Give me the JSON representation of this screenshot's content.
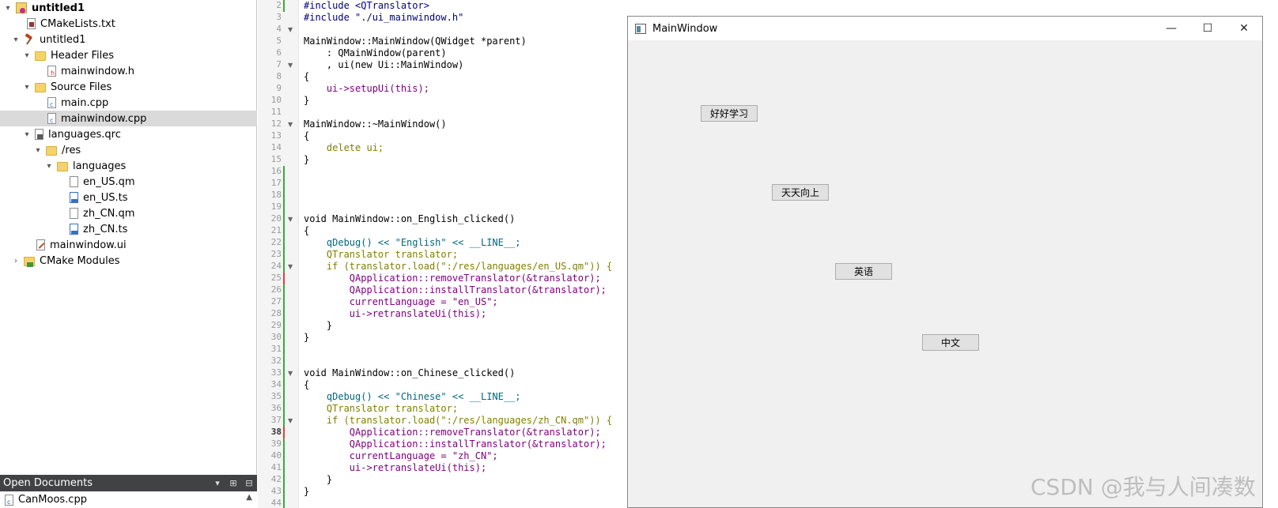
{
  "tree": [
    {
      "label": "untitled1",
      "icon": "project-icon",
      "bold": true
    },
    {
      "label": "CMakeLists.txt",
      "icon": "cmake-file-icon"
    },
    {
      "label": "untitled1",
      "icon": "hammer-icon"
    },
    {
      "label": "Header Files",
      "icon": "folder-icon"
    },
    {
      "label": "mainwindow.h",
      "icon": "header-file-icon"
    },
    {
      "label": "Source Files",
      "icon": "folder-icon"
    },
    {
      "label": "main.cpp",
      "icon": "cpp-file-icon"
    },
    {
      "label": "mainwindow.cpp",
      "icon": "cpp-file-icon",
      "selected": true
    },
    {
      "label": "languages.qrc",
      "icon": "qrc-file-icon"
    },
    {
      "label": "/res",
      "icon": "folder-icon"
    },
    {
      "label": "languages",
      "icon": "folder-icon"
    },
    {
      "label": "en_US.qm",
      "icon": "file-icon"
    },
    {
      "label": "en_US.ts",
      "icon": "ts-file-icon"
    },
    {
      "label": "zh_CN.qm",
      "icon": "file-icon"
    },
    {
      "label": "zh_CN.ts",
      "icon": "ts-file-icon"
    },
    {
      "label": "mainwindow.ui",
      "icon": "ui-file-icon"
    },
    {
      "label": "CMake Modules",
      "icon": "cmake-modules-icon"
    }
  ],
  "open_documents": {
    "title": "Open Documents",
    "items": [
      "CanMoos.cpp"
    ]
  },
  "editor": {
    "line_numbers": [
      "2",
      "3",
      "4",
      "5",
      "6",
      "7",
      "8",
      "9",
      "10",
      "11",
      "12",
      "13",
      "14",
      "15",
      "16",
      "17",
      "18",
      "19",
      "20",
      "21",
      "22",
      "23",
      "24",
      "25",
      "26",
      "27",
      "28",
      "29",
      "30",
      "31",
      "32",
      "33",
      "34",
      "35",
      "36",
      "37",
      "38",
      "39",
      "40",
      "41",
      "42",
      "43",
      "44"
    ],
    "current_line": "38",
    "code_lines": [
      "#include <QTranslator>",
      "#include \"./ui_mainwindow.h\"",
      "",
      "MainWindow::MainWindow(QWidget *parent)",
      "    : QMainWindow(parent)",
      "    , ui(new Ui::MainWindow)",
      "{",
      "    ui->setupUi(this);",
      "}",
      "",
      "MainWindow::~MainWindow()",
      "{",
      "    delete ui;",
      "}",
      "",
      "",
      "",
      "",
      "void MainWindow::on_English_clicked()",
      "{",
      "    qDebug() << \"English\" << __LINE__;",
      "    QTranslator translator;",
      "    if (translator.load(\":/res/languages/en_US.qm\")) {",
      "        QApplication::removeTranslator(&translator);",
      "        QApplication::installTranslator(&translator);",
      "        currentLanguage = \"en_US\";",
      "        ui->retranslateUi(this);",
      "    }",
      "}",
      "",
      "",
      "void MainWindow::on_Chinese_clicked()",
      "{",
      "    qDebug() << \"Chinese\" << __LINE__;",
      "    QTranslator translator;",
      "    if (translator.load(\":/res/languages/zh_CN.qm\")) {",
      "        QApplication::removeTranslator(&translator);",
      "        QApplication::installTranslator(&translator);",
      "        currentLanguage = \"zh_CN\";",
      "        ui->retranslateUi(this);",
      "    }",
      "}",
      ""
    ]
  },
  "main_window": {
    "title": "MainWindow",
    "minimize": "—",
    "maximize": "☐",
    "close": "✕",
    "buttons": [
      "好好学习",
      "天天向上",
      "英语",
      "中文"
    ]
  },
  "watermark": "CSDN @我与人间凑数"
}
